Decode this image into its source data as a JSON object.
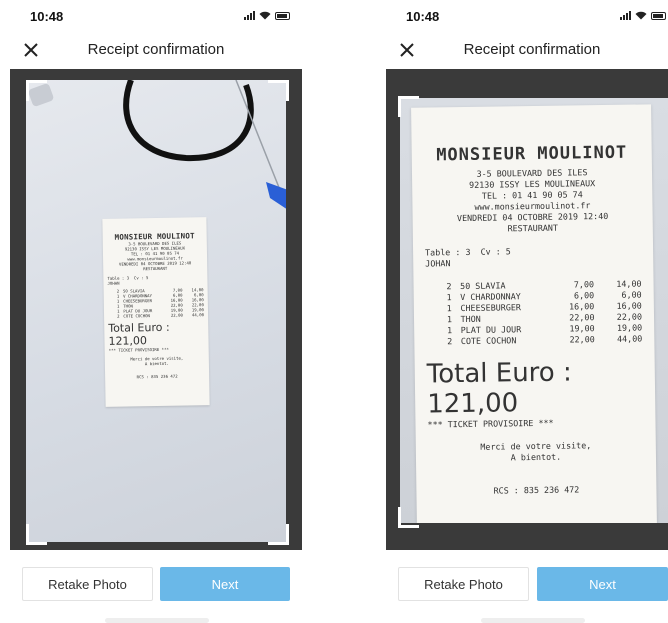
{
  "status_bar": {
    "time": "10:48"
  },
  "header": {
    "title": "Receipt confirmation"
  },
  "buttons": {
    "retake": "Retake Photo",
    "next": "Next"
  },
  "receipt": {
    "name": "MONSIEUR MOULINOT",
    "address1": "3-5 BOULEVARD DES ILES",
    "address2": "92130 ISSY LES MOULINEAUX",
    "tel": "TEL : 01 41 90 05 74",
    "website": "www.monsieurmoulinot.fr",
    "datetime": "VENDREDI 04 OCTOBRE 2019 12:40",
    "type": "RESTAURANT",
    "table_line": "Table : 3  Cv : 5",
    "server": "JOHAN",
    "items": [
      {
        "qty": "2",
        "name": "50 SLAVIA",
        "unit": "7,00",
        "amount": "14,00"
      },
      {
        "qty": "1",
        "name": "V CHARDONNAY",
        "unit": "6,00",
        "amount": "6,00"
      },
      {
        "qty": "1",
        "name": "CHEESEBURGER",
        "unit": "16,00",
        "amount": "16,00"
      },
      {
        "qty": "1",
        "name": "THON",
        "unit": "22,00",
        "amount": "22,00"
      },
      {
        "qty": "1",
        "name": "PLAT DU JOUR",
        "unit": "19,00",
        "amount": "19,00"
      },
      {
        "qty": "2",
        "name": "COTE COCHON",
        "unit": "22,00",
        "amount": "44,00"
      }
    ],
    "total": "Total Euro : 121,00",
    "ticket": "*** TICKET PROVISOIRE ***",
    "thanks1": "Merci de votre visite,",
    "thanks2": "A bientot.",
    "rcs": "RCS : 835 236 472"
  },
  "colors": {
    "next_button": "#6ab8e8",
    "photo_background": "#3a3a3a",
    "cable": "#111111",
    "pen_cap": "#2a5fd6"
  },
  "icons": [
    "signal-icon",
    "wifi-icon",
    "battery-icon",
    "close-icon"
  ]
}
